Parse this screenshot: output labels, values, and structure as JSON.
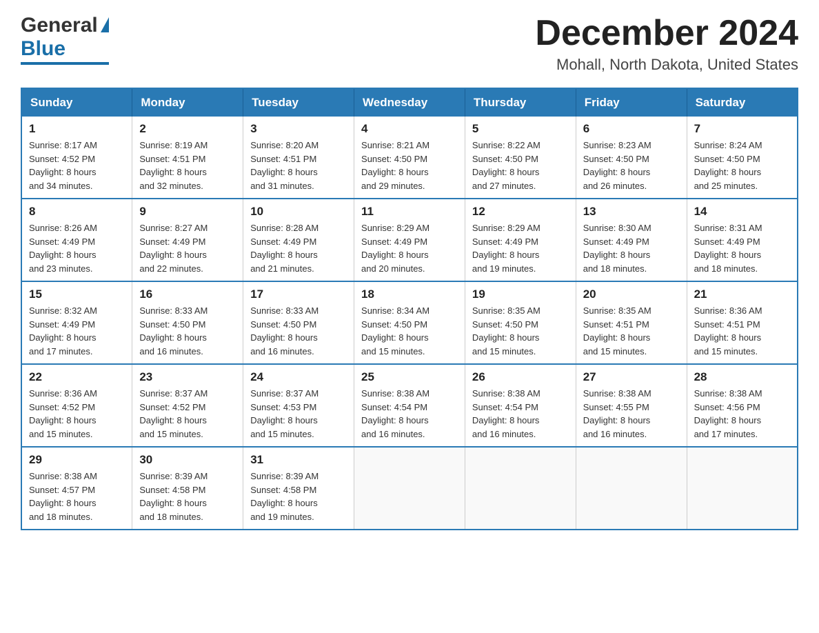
{
  "header": {
    "logo": {
      "general": "General",
      "blue": "Blue",
      "triangle": "▲"
    },
    "month_title": "December 2024",
    "location": "Mohall, North Dakota, United States"
  },
  "weekdays": [
    "Sunday",
    "Monday",
    "Tuesday",
    "Wednesday",
    "Thursday",
    "Friday",
    "Saturday"
  ],
  "weeks": [
    [
      {
        "day": "1",
        "sunrise": "8:17 AM",
        "sunset": "4:52 PM",
        "daylight": "8 hours and 34 minutes."
      },
      {
        "day": "2",
        "sunrise": "8:19 AM",
        "sunset": "4:51 PM",
        "daylight": "8 hours and 32 minutes."
      },
      {
        "day": "3",
        "sunrise": "8:20 AM",
        "sunset": "4:51 PM",
        "daylight": "8 hours and 31 minutes."
      },
      {
        "day": "4",
        "sunrise": "8:21 AM",
        "sunset": "4:50 PM",
        "daylight": "8 hours and 29 minutes."
      },
      {
        "day": "5",
        "sunrise": "8:22 AM",
        "sunset": "4:50 PM",
        "daylight": "8 hours and 27 minutes."
      },
      {
        "day": "6",
        "sunrise": "8:23 AM",
        "sunset": "4:50 PM",
        "daylight": "8 hours and 26 minutes."
      },
      {
        "day": "7",
        "sunrise": "8:24 AM",
        "sunset": "4:50 PM",
        "daylight": "8 hours and 25 minutes."
      }
    ],
    [
      {
        "day": "8",
        "sunrise": "8:26 AM",
        "sunset": "4:49 PM",
        "daylight": "8 hours and 23 minutes."
      },
      {
        "day": "9",
        "sunrise": "8:27 AM",
        "sunset": "4:49 PM",
        "daylight": "8 hours and 22 minutes."
      },
      {
        "day": "10",
        "sunrise": "8:28 AM",
        "sunset": "4:49 PM",
        "daylight": "8 hours and 21 minutes."
      },
      {
        "day": "11",
        "sunrise": "8:29 AM",
        "sunset": "4:49 PM",
        "daylight": "8 hours and 20 minutes."
      },
      {
        "day": "12",
        "sunrise": "8:29 AM",
        "sunset": "4:49 PM",
        "daylight": "8 hours and 19 minutes."
      },
      {
        "day": "13",
        "sunrise": "8:30 AM",
        "sunset": "4:49 PM",
        "daylight": "8 hours and 18 minutes."
      },
      {
        "day": "14",
        "sunrise": "8:31 AM",
        "sunset": "4:49 PM",
        "daylight": "8 hours and 18 minutes."
      }
    ],
    [
      {
        "day": "15",
        "sunrise": "8:32 AM",
        "sunset": "4:49 PM",
        "daylight": "8 hours and 17 minutes."
      },
      {
        "day": "16",
        "sunrise": "8:33 AM",
        "sunset": "4:50 PM",
        "daylight": "8 hours and 16 minutes."
      },
      {
        "day": "17",
        "sunrise": "8:33 AM",
        "sunset": "4:50 PM",
        "daylight": "8 hours and 16 minutes."
      },
      {
        "day": "18",
        "sunrise": "8:34 AM",
        "sunset": "4:50 PM",
        "daylight": "8 hours and 15 minutes."
      },
      {
        "day": "19",
        "sunrise": "8:35 AM",
        "sunset": "4:50 PM",
        "daylight": "8 hours and 15 minutes."
      },
      {
        "day": "20",
        "sunrise": "8:35 AM",
        "sunset": "4:51 PM",
        "daylight": "8 hours and 15 minutes."
      },
      {
        "day": "21",
        "sunrise": "8:36 AM",
        "sunset": "4:51 PM",
        "daylight": "8 hours and 15 minutes."
      }
    ],
    [
      {
        "day": "22",
        "sunrise": "8:36 AM",
        "sunset": "4:52 PM",
        "daylight": "8 hours and 15 minutes."
      },
      {
        "day": "23",
        "sunrise": "8:37 AM",
        "sunset": "4:52 PM",
        "daylight": "8 hours and 15 minutes."
      },
      {
        "day": "24",
        "sunrise": "8:37 AM",
        "sunset": "4:53 PM",
        "daylight": "8 hours and 15 minutes."
      },
      {
        "day": "25",
        "sunrise": "8:38 AM",
        "sunset": "4:54 PM",
        "daylight": "8 hours and 16 minutes."
      },
      {
        "day": "26",
        "sunrise": "8:38 AM",
        "sunset": "4:54 PM",
        "daylight": "8 hours and 16 minutes."
      },
      {
        "day": "27",
        "sunrise": "8:38 AM",
        "sunset": "4:55 PM",
        "daylight": "8 hours and 16 minutes."
      },
      {
        "day": "28",
        "sunrise": "8:38 AM",
        "sunset": "4:56 PM",
        "daylight": "8 hours and 17 minutes."
      }
    ],
    [
      {
        "day": "29",
        "sunrise": "8:38 AM",
        "sunset": "4:57 PM",
        "daylight": "8 hours and 18 minutes."
      },
      {
        "day": "30",
        "sunrise": "8:39 AM",
        "sunset": "4:58 PM",
        "daylight": "8 hours and 18 minutes."
      },
      {
        "day": "31",
        "sunrise": "8:39 AM",
        "sunset": "4:58 PM",
        "daylight": "8 hours and 19 minutes."
      },
      null,
      null,
      null,
      null
    ]
  ],
  "labels": {
    "sunrise": "Sunrise:",
    "sunset": "Sunset:",
    "daylight": "Daylight:"
  }
}
